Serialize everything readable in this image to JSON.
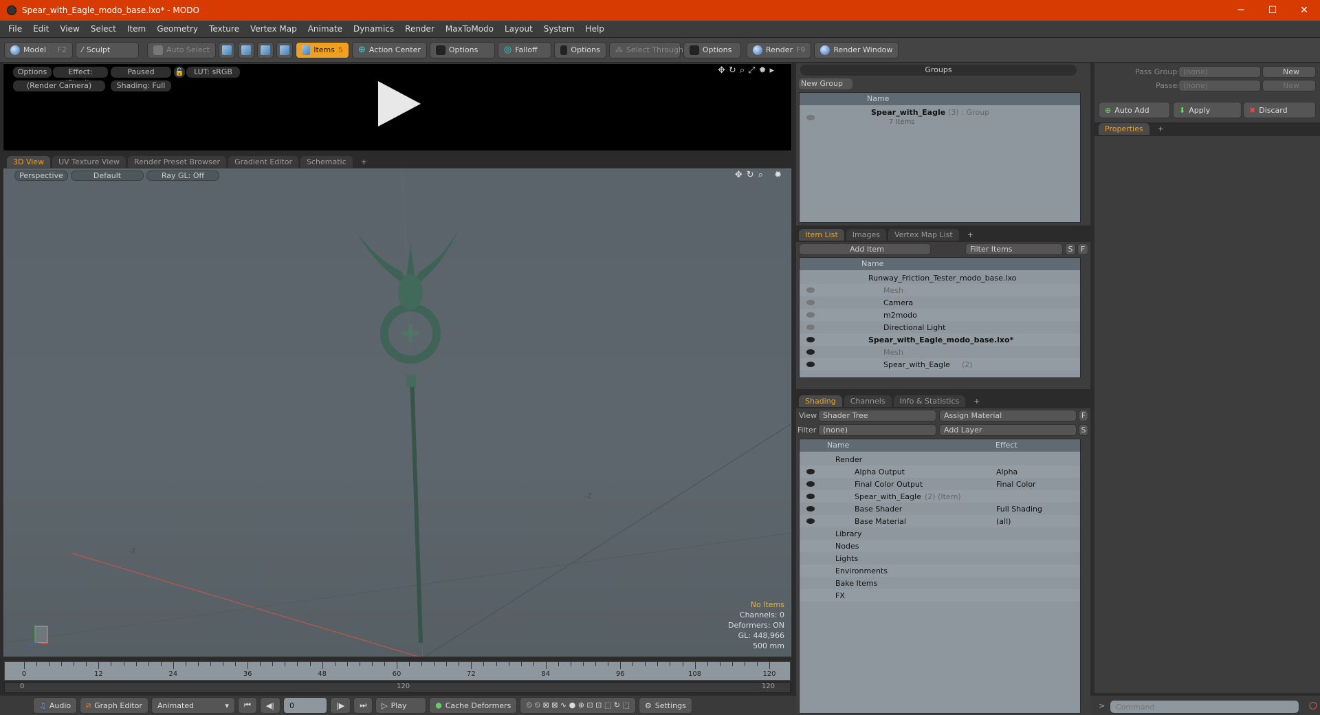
{
  "window": {
    "title": "Spear_with_Eagle_modo_base.lxo* - MODO",
    "minimize": "─",
    "maximize": "☐",
    "close": "✕"
  },
  "menu": [
    "File",
    "Edit",
    "View",
    "Select",
    "Item",
    "Geometry",
    "Texture",
    "Vertex Map",
    "Animate",
    "Dynamics",
    "Render",
    "MaxToModo",
    "Layout",
    "System",
    "Help"
  ],
  "toolbar": {
    "model": "Model",
    "model_key": "F2",
    "sculpt": "Sculpt",
    "auto_select": "Auto Select",
    "items": "Items",
    "items_key": "5",
    "action_center": "Action Center",
    "options1": "Options",
    "falloff": "Falloff",
    "options2": "Options",
    "select_through": "Select Through",
    "options3": "Options",
    "render": "Render",
    "render_key": "F9",
    "render_window": "Render Window"
  },
  "render_preview": {
    "options": "Options",
    "effect": "Effect: (Shadi...",
    "paused": "Paused",
    "lut": "LUT: sRGB",
    "camera": "(Render Camera)",
    "shading": "Shading: Full"
  },
  "viewport_tabs": [
    "3D View",
    "UV Texture View",
    "Render Preset Browser",
    "Gradient Editor",
    "Schematic"
  ],
  "viewport": {
    "projection": "Perspective",
    "style": "Default",
    "raygl": "Ray GL: Off",
    "axis_neg_x": "-X",
    "axis_neg_z": "-Z",
    "hud": {
      "selection": "No Items",
      "channels": "Channels: 0",
      "deformers": "Deformers: ON",
      "gl": "GL: 448,966",
      "scale": "500 mm"
    },
    "hud_accent": "#f0b030"
  },
  "groups": {
    "title": "Groups",
    "new_group": "New Group",
    "col_name": "Name",
    "rows": [
      {
        "name": "Spear_with_Eagle",
        "count": "(3)",
        "type": ": Group",
        "sub": "7 Items"
      }
    ]
  },
  "passes": {
    "pass_groups_label": "Pass Groups",
    "pass_groups_value": "(none)",
    "new1": "New",
    "passes_label": "Passes",
    "passes_value": "(none)",
    "new2": "New",
    "auto_add": "Auto Add",
    "apply": "Apply",
    "discard": "Discard"
  },
  "properties_tab": "Properties",
  "item_list": {
    "tabs": [
      "Item List",
      "Images",
      "Vertex Map List"
    ],
    "add_item": "Add Item",
    "filter": "Filter Items",
    "s": "S",
    "f": "F",
    "col_name": "Name",
    "rows": [
      {
        "name": "Runway_Friction_Tester_modo_base.lxo",
        "indent": 0,
        "style": "normal",
        "eye": "none"
      },
      {
        "name": "Mesh",
        "indent": 1,
        "style": "gray",
        "eye": "dim"
      },
      {
        "name": "Camera",
        "indent": 1,
        "style": "normal",
        "eye": "dim"
      },
      {
        "name": "m2modo",
        "indent": 1,
        "style": "normal",
        "eye": "dim"
      },
      {
        "name": "Directional Light",
        "indent": 1,
        "style": "normal",
        "eye": "dim"
      },
      {
        "name": "Spear_with_Eagle_modo_base.lxo*",
        "indent": 0,
        "style": "bold",
        "eye": "on"
      },
      {
        "name": "Mesh",
        "indent": 1,
        "style": "gray",
        "eye": "on"
      },
      {
        "name": "Spear_with_Eagle",
        "suffix": "(2)",
        "indent": 1,
        "style": "normal",
        "eye": "on"
      }
    ]
  },
  "shading": {
    "tabs": [
      "Shading",
      "Channels",
      "Info & Statistics"
    ],
    "view_label": "View",
    "view_value": "Shader Tree",
    "assign_material": "Assign Material",
    "f": "F",
    "filter_label": "Filter",
    "filter_value": "(none)",
    "add_layer": "Add Layer",
    "s": "S",
    "col_name": "Name",
    "col_effect": "Effect",
    "rows": [
      {
        "name": "Render",
        "effect": "",
        "indent": 0,
        "eye": false
      },
      {
        "name": "Alpha Output",
        "effect": "Alpha",
        "indent": 1,
        "eye": true
      },
      {
        "name": "Final Color Output",
        "effect": "Final Color",
        "indent": 1,
        "eye": true
      },
      {
        "name": "Spear_with_Eagle",
        "suffix": "(2) (Item)",
        "effect": "",
        "indent": 1,
        "eye": true
      },
      {
        "name": "Base Shader",
        "effect": "Full Shading",
        "indent": 1,
        "eye": true
      },
      {
        "name": "Base Material",
        "effect": "(all)",
        "indent": 1,
        "eye": true
      },
      {
        "name": "Library",
        "effect": "",
        "indent": 0,
        "eye": false
      },
      {
        "name": "Nodes",
        "effect": "",
        "indent": 0,
        "eye": false
      },
      {
        "name": "Lights",
        "effect": "",
        "indent": 0,
        "eye": false
      },
      {
        "name": "Environments",
        "effect": "",
        "indent": 0,
        "eye": false
      },
      {
        "name": "Bake Items",
        "effect": "",
        "indent": 0,
        "eye": false
      },
      {
        "name": "FX",
        "effect": "",
        "indent": 0,
        "eye": false
      }
    ]
  },
  "timeline": {
    "ticks": [
      "0",
      "12",
      "24",
      "36",
      "48",
      "60",
      "72",
      "84",
      "96",
      "108",
      "120"
    ],
    "range_start": "0",
    "range_mid": "120",
    "range_end": "120",
    "current_frame": 0
  },
  "bottom_bar": {
    "audio": "Audio",
    "graph_editor": "Graph Editor",
    "animated": "Animated",
    "frame": "0",
    "play": "Play",
    "cache_deformers": "Cache Deformers",
    "settings": "Settings"
  },
  "command": {
    "placeholder": "Command",
    "prompt": ">"
  }
}
